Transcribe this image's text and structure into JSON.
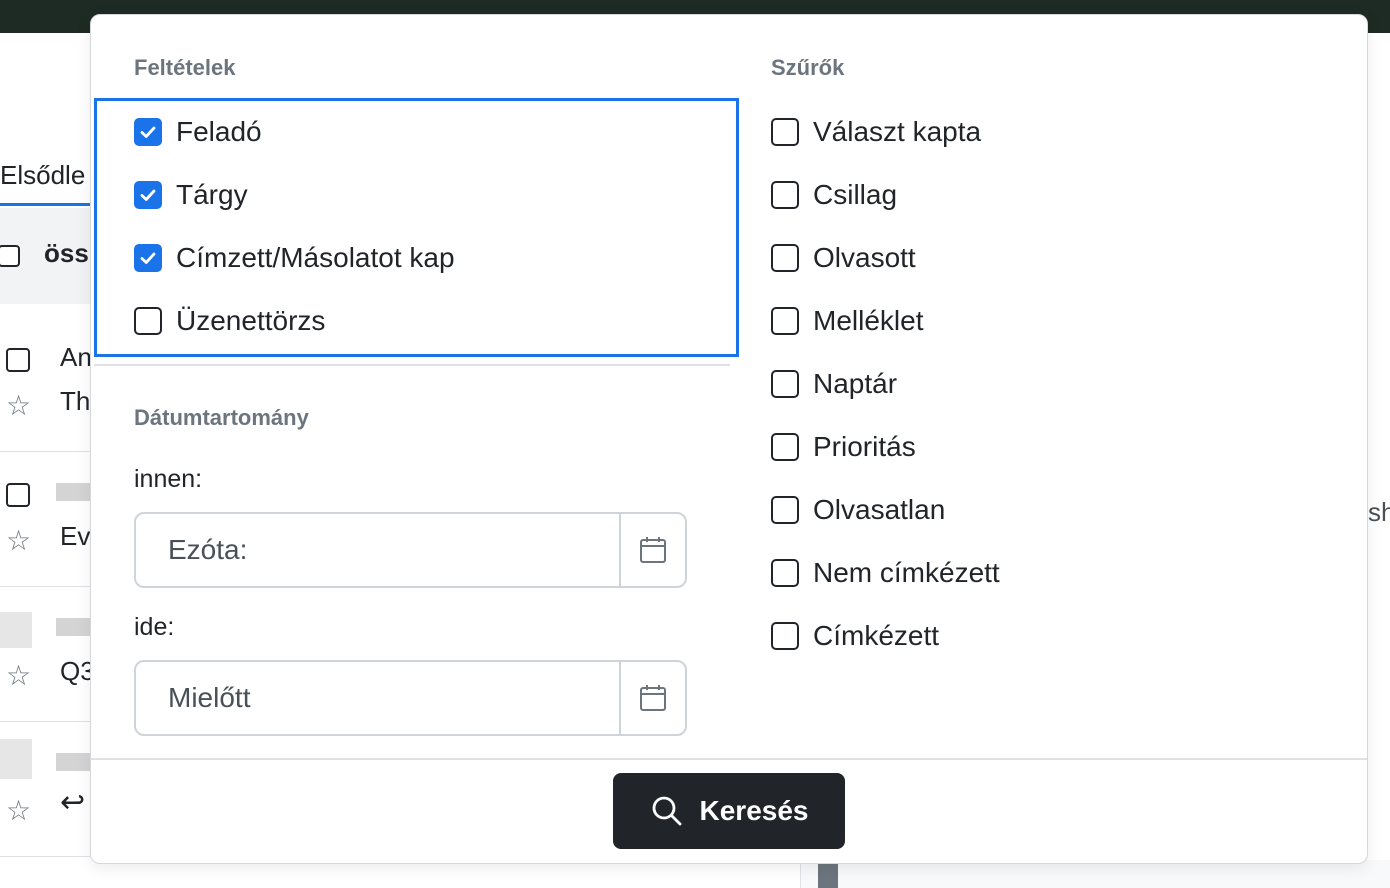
{
  "background": {
    "tab_label": "Elsődle",
    "select_all_label": "öss",
    "rows": [
      {
        "line1": "An",
        "line2": "Th"
      },
      {
        "line1": "",
        "line2": "Ev"
      },
      {
        "line1": "",
        "line2": "Q3"
      },
      {
        "line1": "",
        "line2": ""
      }
    ],
    "right_fragment": "sh"
  },
  "conditions": {
    "title": "Feltételek",
    "items": [
      {
        "label": "Feladó",
        "checked": true
      },
      {
        "label": "Tárgy",
        "checked": true
      },
      {
        "label": "Címzett/Másolatot kap",
        "checked": true
      },
      {
        "label": "Üzenettörzs",
        "checked": false
      }
    ]
  },
  "date_range": {
    "title": "Dátumtartomány",
    "from_label": "innen:",
    "from_placeholder": "Ezóta:",
    "to_label": "ide:",
    "to_placeholder": "Mielőtt"
  },
  "filters": {
    "title": "Szűrők",
    "items": [
      {
        "label": "Választ kapta",
        "checked": false
      },
      {
        "label": "Csillag",
        "checked": false
      },
      {
        "label": "Olvasott",
        "checked": false
      },
      {
        "label": "Melléklet",
        "checked": false
      },
      {
        "label": "Naptár",
        "checked": false
      },
      {
        "label": "Prioritás",
        "checked": false
      },
      {
        "label": "Olvasatlan",
        "checked": false
      },
      {
        "label": "Nem címkézett",
        "checked": false
      },
      {
        "label": "Címkézett",
        "checked": false
      }
    ]
  },
  "search_button": {
    "label": "Keresés",
    "icon": "search-icon"
  },
  "colors": {
    "accent": "#1a73e8",
    "button": "#212529"
  }
}
